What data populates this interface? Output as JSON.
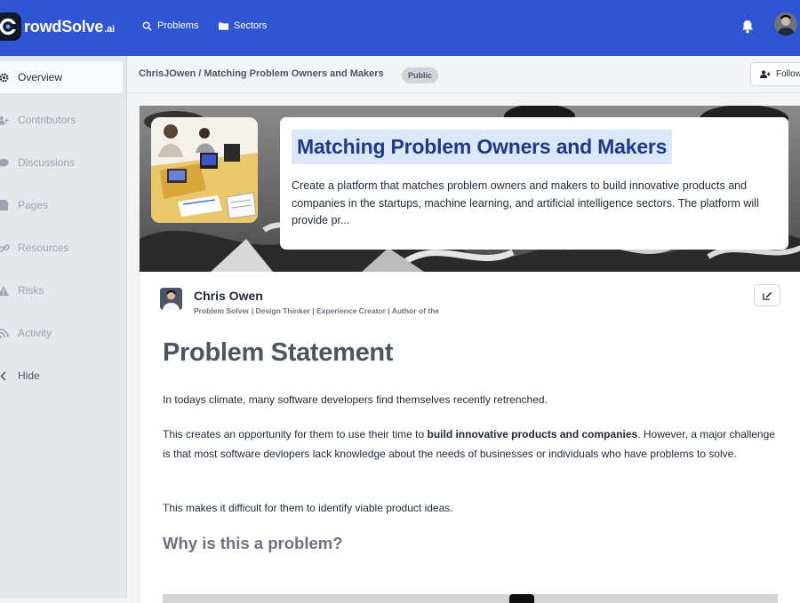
{
  "brand": {
    "name": "rowdSolve",
    "suffix": ".ai"
  },
  "topnav": {
    "problems_label": "Problems",
    "sectors_label": "Sectors"
  },
  "sidebar": {
    "items": [
      {
        "label": "Overview",
        "icon": "gear-icon",
        "active": true
      },
      {
        "label": "Contributors",
        "icon": "user-plus-icon"
      },
      {
        "label": "Discussions",
        "icon": "chat-bubble-icon"
      },
      {
        "label": "Pages",
        "icon": "document-icon"
      },
      {
        "label": "Resources",
        "icon": "link-icon"
      },
      {
        "label": "Risks",
        "icon": "warning-icon"
      },
      {
        "label": "Activity",
        "icon": "rss-icon"
      },
      {
        "label": "Hide",
        "icon": "chevron-left-icon"
      }
    ]
  },
  "breadcrumb": {
    "path": "ChrisJOwen / Matching Problem Owners and Makers",
    "visibility": "Public",
    "follow_label": "Follow"
  },
  "hero": {
    "title": "Matching Problem Owners and Makers",
    "description": "Create a platform that matches problem owners and makers to build innovative products and companies in the startups, machine learning, and artificial intelligence sectors. The platform will provide pr..."
  },
  "author": {
    "name": "Chris Owen",
    "bio": "Problem Solver | Design Thinker | Experience Creator | Author of the"
  },
  "content": {
    "heading": "Problem Statement",
    "p1": "In todays climate, many software developers find themselves recently retrenched.",
    "p2_before": "This creates an opportunity for them to use their time to ",
    "p2_bold": "build innovative products and companies",
    "p2_after": ". However, a major challenge is that most software devlopers lack knowledge about the needs of businesses or individuals who have problems to solve.",
    "p3": "This makes it difficult for them to identify viable product ideas.",
    "subheading": "Why is this a problem?"
  },
  "colors": {
    "topbar": "#2f55d4",
    "title_highlight": "#dbe8f9",
    "title_text": "#1f3a8a"
  }
}
